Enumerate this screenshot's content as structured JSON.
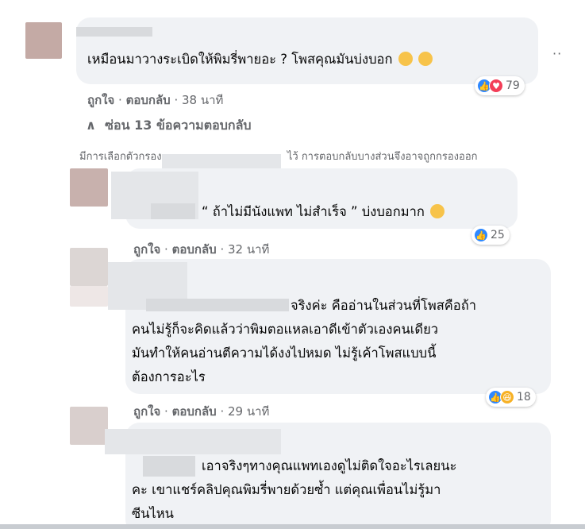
{
  "comments": [
    {
      "text_lines": [
        "เหมือนมาวางระเบิดให้พิมรี่พายอะ ? โพสคุณมันบ่งบอก"
      ],
      "emoji": [
        "grinning-face-icon",
        "grinning-face-icon"
      ],
      "reaction_count": "79",
      "like_label": "ถูกใจ",
      "reply_label": "ตอบกลับ",
      "time": "38 นาที"
    },
    {
      "text_lines": [
        "“ ถ้าไม่มีนังแพท ไม่สำเร็จ ” บ่งบอกมาก"
      ],
      "emoji": [
        "grinning-face-icon"
      ],
      "reaction_count": "25",
      "like_label": "ถูกใจ",
      "reply_label": "ตอบกลับ",
      "time": "32 นาที"
    },
    {
      "text_lines": [
        "จริงค่ะ คืออ่านในส่วนที่โพสคือถ้า",
        "คนไม่รู้ก็จะคิดแล้วว่าพิมตอแหลเอาดีเข้าตัวเองคนเดียว",
        "มันทำให้คนอ่านตีความได้งงไปหมด ไม่รู้เค้าโพสแบบนี้",
        "ต้องการอะไร"
      ],
      "reaction_count": "18",
      "like_label": "ถูกใจ",
      "reply_label": "ตอบกลับ",
      "time": "29 นาที"
    },
    {
      "text_lines": [
        "เอาจริงๆทางคุณแพทเองดูไม่ติดใจอะไรเลยนะ",
        "คะ เขาแชร์คลิปคุณพิมรี่พายด้วยซ้ำ แต่คุณเพื่อนไม่รู้มา",
        "ซีนไหน"
      ]
    }
  ],
  "hide_replies": "ซ่อน 13 ข้อความตอบกลับ",
  "filter_notice_start": "มีการเลือกตัวกรอง",
  "filter_notice_end": "ไว้ การตอบกลับบางส่วนจึงอาจถูกกรองออก",
  "more_options": "··",
  "colors": {
    "like": "#2d88ff",
    "love": "#f33e58",
    "haha": "#f7b125",
    "bubble": "#f0f2f5",
    "meta_text": "#65676b"
  }
}
